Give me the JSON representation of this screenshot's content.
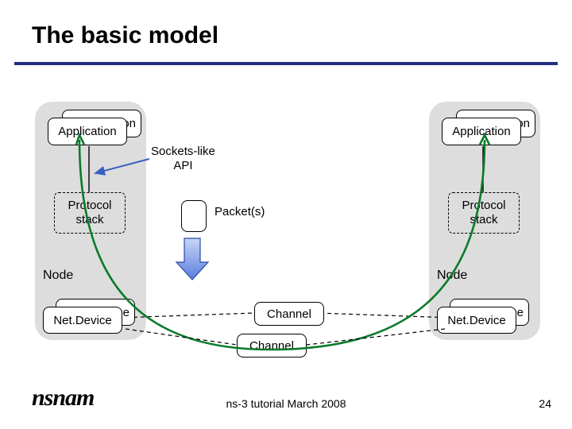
{
  "title": "The basic model",
  "left": {
    "app_back_suffix": "on",
    "app_front": "Application",
    "protocol": "Protocol\nstack",
    "node": "Node",
    "netdev_back_suffix": "ce",
    "netdev_front": "Net.Device"
  },
  "right": {
    "app_back_suffix": "on",
    "app_front": "Application",
    "protocol": "Protocol\nstack",
    "node": "Node",
    "netdev_back_suffix": "ce",
    "netdev_front": "Net.Device"
  },
  "labels": {
    "sockets": "Sockets-like\nAPI",
    "packets": "Packet(s)",
    "channel_top": "Channel",
    "channel_bottom": "Channel"
  },
  "footer": {
    "logo": "nsnam",
    "text": "ns-3 tutorial March 2008",
    "page": "24"
  }
}
